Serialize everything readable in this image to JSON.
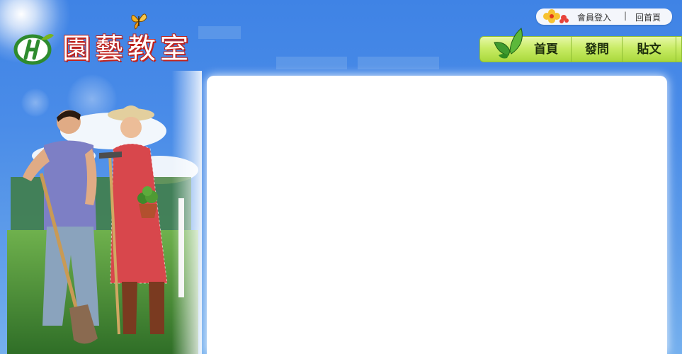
{
  "logo": {
    "text": "園藝教室",
    "mark_icon": "leaf-h-logo-icon"
  },
  "top_links": {
    "login": "會員登入",
    "separator": "|",
    "home": "回首頁",
    "icon": "flower-icon"
  },
  "nav": {
    "items": [
      {
        "label": "首頁"
      },
      {
        "label": "發問"
      },
      {
        "label": "貼文"
      }
    ],
    "icon": "leaf-icon"
  },
  "colors": {
    "sky": "#4a8ce8",
    "nav_green": "#c9ec66",
    "logo_red": "#c0221c",
    "panel": "#ffffff"
  }
}
